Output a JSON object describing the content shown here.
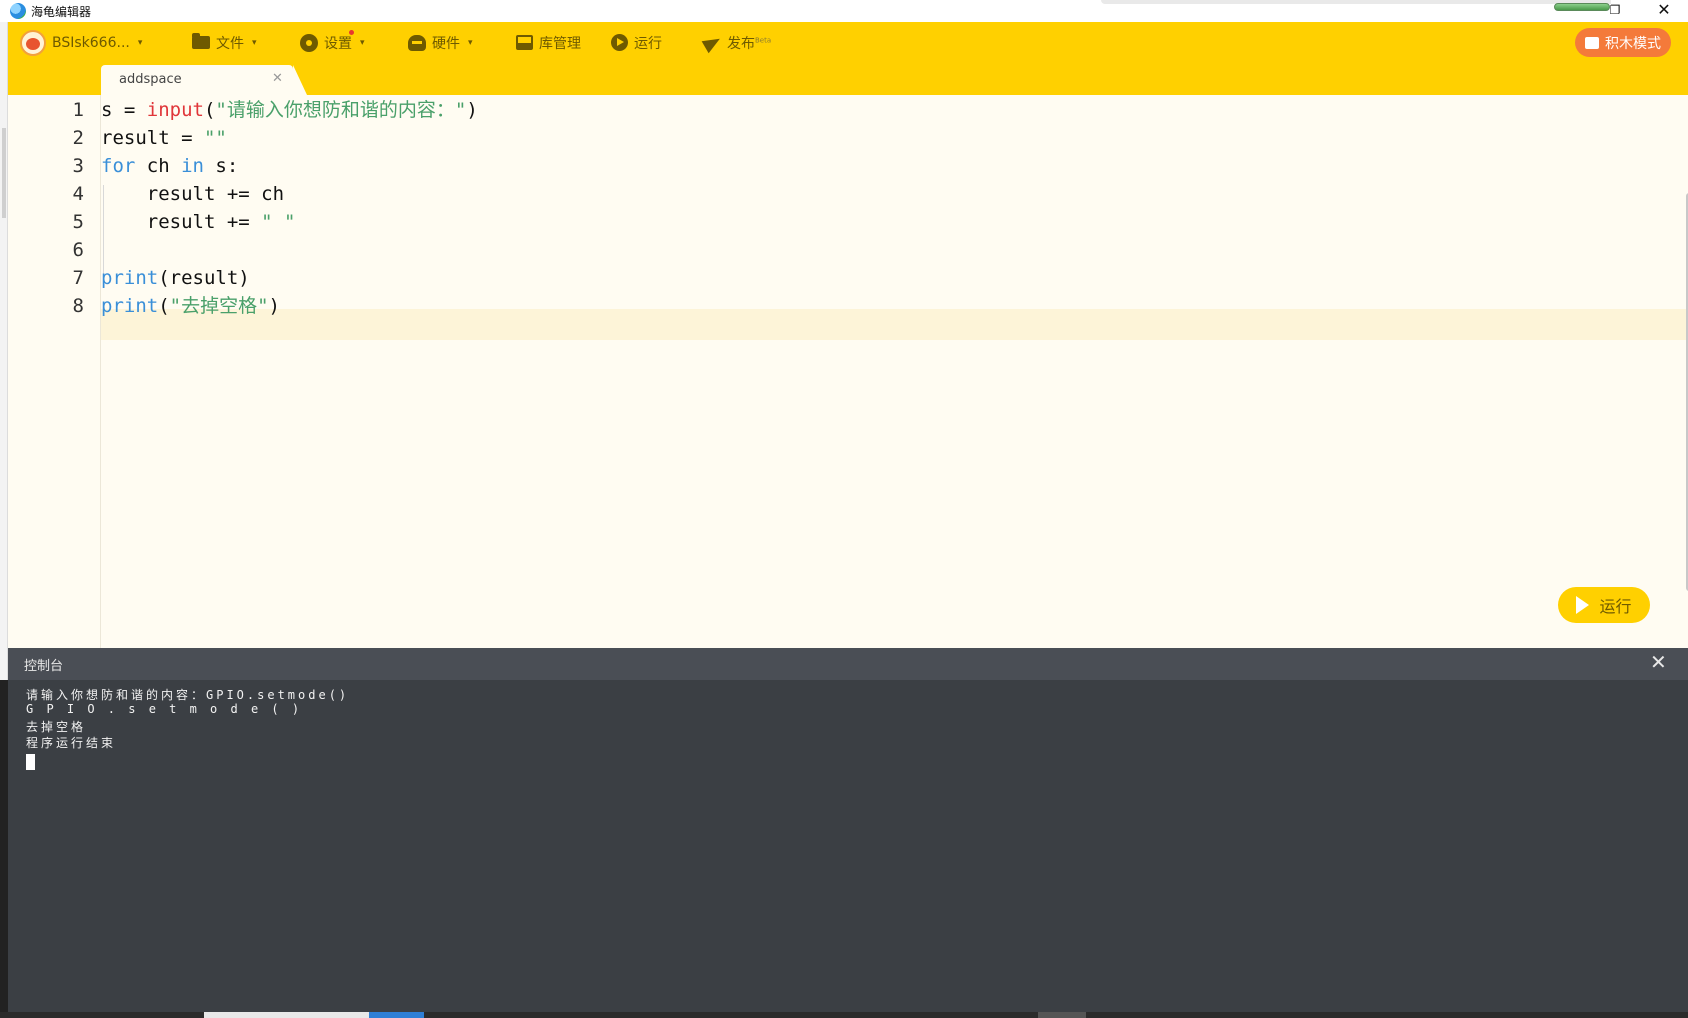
{
  "window": {
    "title": "海龟编辑器",
    "restore_symbol": "❐",
    "close_symbol": "✕"
  },
  "toolbar": {
    "user": {
      "label": "BSIsk666...",
      "icon": "avatar-icon"
    },
    "file": {
      "label": "文件",
      "icon": "folder-icon"
    },
    "settings": {
      "label": "设置",
      "icon": "gear-icon"
    },
    "hardware": {
      "label": "硬件",
      "icon": "robot-icon"
    },
    "library": {
      "label": "库管理",
      "icon": "inbox-icon"
    },
    "run": {
      "label": "运行",
      "icon": "play-icon"
    },
    "publish": {
      "label": "发布",
      "beta": "Beta",
      "icon": "send-icon"
    },
    "block_mode": {
      "label": "积木模式",
      "icon": "blocks-icon"
    },
    "caret": "▾"
  },
  "tabs": [
    {
      "label": "addspace",
      "close": "✕"
    }
  ],
  "editor": {
    "line_numbers": [
      "1",
      "2",
      "3",
      "4",
      "5",
      "6",
      "7",
      "8"
    ],
    "current_line": 8,
    "lines": [
      [
        {
          "t": "s = ",
          "c": ""
        },
        {
          "t": "input",
          "c": "fn"
        },
        {
          "t": "(",
          "c": ""
        },
        {
          "t": "\"请输入你想防和谐的内容：\"",
          "c": "str"
        },
        {
          "t": ")",
          "c": ""
        }
      ],
      [
        {
          "t": "result = ",
          "c": ""
        },
        {
          "t": "\"\"",
          "c": "str"
        }
      ],
      [
        {
          "t": "for",
          "c": "kw"
        },
        {
          "t": " ch ",
          "c": ""
        },
        {
          "t": "in",
          "c": "kw"
        },
        {
          "t": " s:",
          "c": ""
        }
      ],
      [
        {
          "t": "    result += ch",
          "c": ""
        }
      ],
      [
        {
          "t": "    result += ",
          "c": ""
        },
        {
          "t": "\" \"",
          "c": "str"
        }
      ],
      [
        {
          "t": "",
          "c": ""
        }
      ],
      [
        {
          "t": "print",
          "c": "kw"
        },
        {
          "t": "(result)",
          "c": ""
        }
      ],
      [
        {
          "t": "print",
          "c": "kw"
        },
        {
          "t": "(",
          "c": ""
        },
        {
          "t": "\"去掉空格\"",
          "c": "str"
        },
        {
          "t": ")",
          "c": ""
        }
      ]
    ],
    "run_button_label": "运行"
  },
  "console": {
    "title": "控制台",
    "close": "✕",
    "lines": [
      "请输入你想防和谐的内容：GPIO.setmode()",
      "G P I O . s e t m o d e ( )",
      "去掉空格",
      "程序运行结束"
    ]
  },
  "colors": {
    "toolbar_bg": "#ffd000",
    "accent_orange": "#f47a3a",
    "editor_bg": "#fffcf2",
    "console_bg": "#3b3f44",
    "keyword": "#3a8fd8",
    "builtin_fn": "#e0363a",
    "string": "#4aa06a"
  }
}
